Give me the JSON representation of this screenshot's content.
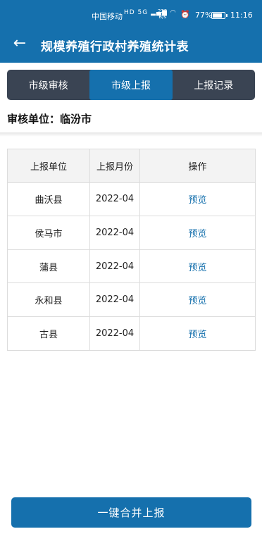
{
  "status_bar": {
    "carrier": "中国移动",
    "network": "HD 5G",
    "speed_value": "225",
    "speed_unit": "B/s",
    "battery": "77%",
    "time": "11:16"
  },
  "header": {
    "title": "规模养殖行政村养殖统计表"
  },
  "tabs": [
    {
      "label": "市级审核",
      "active": false
    },
    {
      "label": "市级上报",
      "active": true
    },
    {
      "label": "上报记录",
      "active": false
    }
  ],
  "org": {
    "text": "审核单位：临汾市"
  },
  "table": {
    "headers": [
      "上报单位",
      "上报月份",
      "操作"
    ],
    "rows": [
      {
        "unit": "曲沃县",
        "month": "2022-04",
        "action": "预览"
      },
      {
        "unit": "侯马市",
        "month": "2022-04",
        "action": "预览"
      },
      {
        "unit": "蒲县",
        "month": "2022-04",
        "action": "预览"
      },
      {
        "unit": "永和县",
        "month": "2022-04",
        "action": "预览"
      },
      {
        "unit": "古县",
        "month": "2022-04",
        "action": "预览"
      }
    ]
  },
  "footer": {
    "merge_label": "一键合并上报"
  },
  "colors": {
    "primary": "#1570ad",
    "tab_bar": "#3a4453"
  }
}
